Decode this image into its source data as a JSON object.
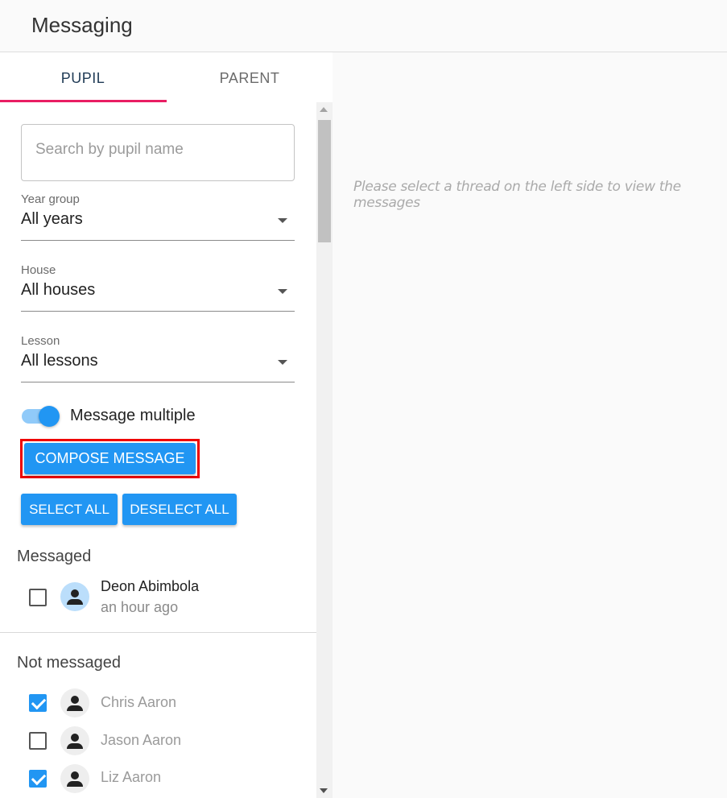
{
  "header": {
    "title": "Messaging"
  },
  "tabs": [
    {
      "label": "PUPIL",
      "active": true
    },
    {
      "label": "PARENT",
      "active": false
    }
  ],
  "filters": {
    "search_placeholder": "Search by pupil name",
    "year": {
      "label": "Year group",
      "value": "All years"
    },
    "house": {
      "label": "House",
      "value": "All houses"
    },
    "lesson": {
      "label": "Lesson",
      "value": "All lessons"
    }
  },
  "toggle": {
    "label": "Message multiple",
    "on": true
  },
  "buttons": {
    "compose": "COMPOSE MESSAGE",
    "select_all": "SELECT ALL",
    "deselect_all": "DESELECT ALL"
  },
  "messaged": {
    "title": "Messaged",
    "items": [
      {
        "name": "Deon Abimbola",
        "time": "an hour ago",
        "checked": false
      }
    ]
  },
  "not_messaged": {
    "title": "Not messaged",
    "items": [
      {
        "name": "Chris Aaron",
        "checked": true
      },
      {
        "name": "Jason Aaron",
        "checked": false
      },
      {
        "name": "Liz Aaron",
        "checked": true
      }
    ]
  },
  "main": {
    "empty_message": "Please select a thread on the left side to view the messages"
  },
  "colors": {
    "accent": "#2196f3",
    "tab_indicator": "#e91e63",
    "highlight": "#e00000"
  }
}
